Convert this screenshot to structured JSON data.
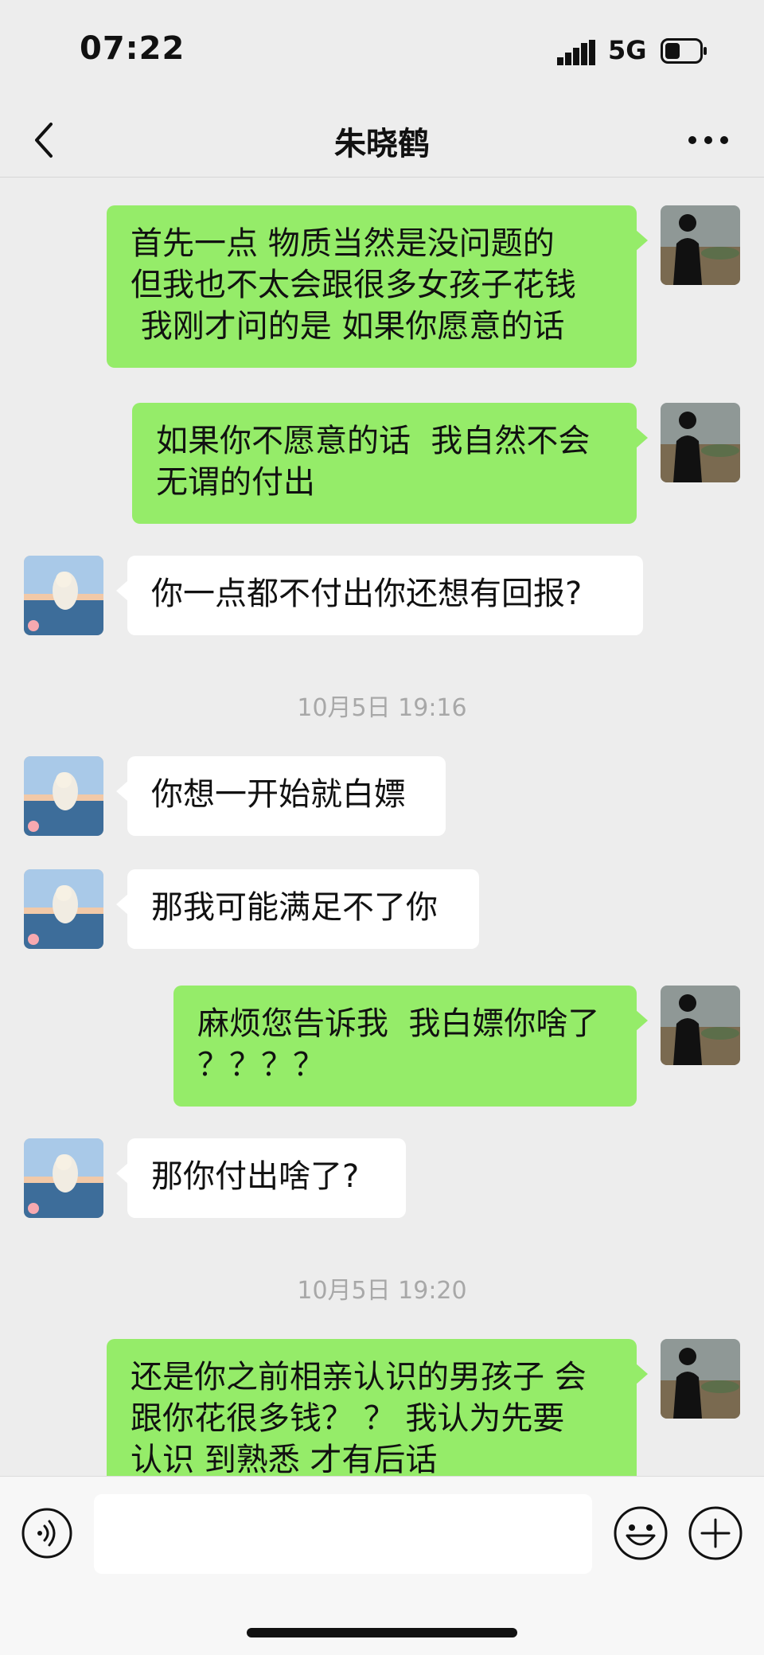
{
  "status_bar": {
    "time": "07:22",
    "network": "5G",
    "signal_icon": "signal-bars-icon",
    "battery_icon": "battery-icon"
  },
  "nav": {
    "title": "朱晓鹤",
    "back_icon": "chevron-left-icon",
    "more_icon": "more-horizontal-icon"
  },
  "messages": [
    {
      "from": "me",
      "text": "首先一点 物质当然是没问题的\n但我也不太会跟很多女孩子花钱\n 我刚才问的是 如果你愿意的话"
    },
    {
      "from": "me",
      "text": "如果你不愿意的话  我自然不会\n无谓的付出"
    },
    {
      "from": "other",
      "text": "你一点都不付出你还想有回报?"
    },
    {
      "from": "other",
      "text": "你想一开始就白嫖"
    },
    {
      "from": "other",
      "text": "那我可能满足不了你"
    },
    {
      "from": "me",
      "text": "麻烦您告诉我  我白嫖你啥了\n？？？？"
    },
    {
      "from": "other",
      "text": "那你付出啥了?"
    },
    {
      "from": "me",
      "text": "还是你之前相亲认识的男孩子 会\n跟你花很多钱？ ？ 我认为先要\n认识 到熟悉 才有后话"
    }
  ],
  "timestamps": [
    "10月5日 19:16",
    "10月5日 19:20"
  ],
  "input_bar": {
    "voice_icon": "voice-icon",
    "emoji_icon": "emoji-icon",
    "plus_icon": "plus-icon",
    "input_value": ""
  },
  "colors": {
    "background": "#ededed",
    "my_bubble": "#95ec69",
    "their_bubble": "#ffffff",
    "timestamp_text": "#a8a8a8"
  }
}
